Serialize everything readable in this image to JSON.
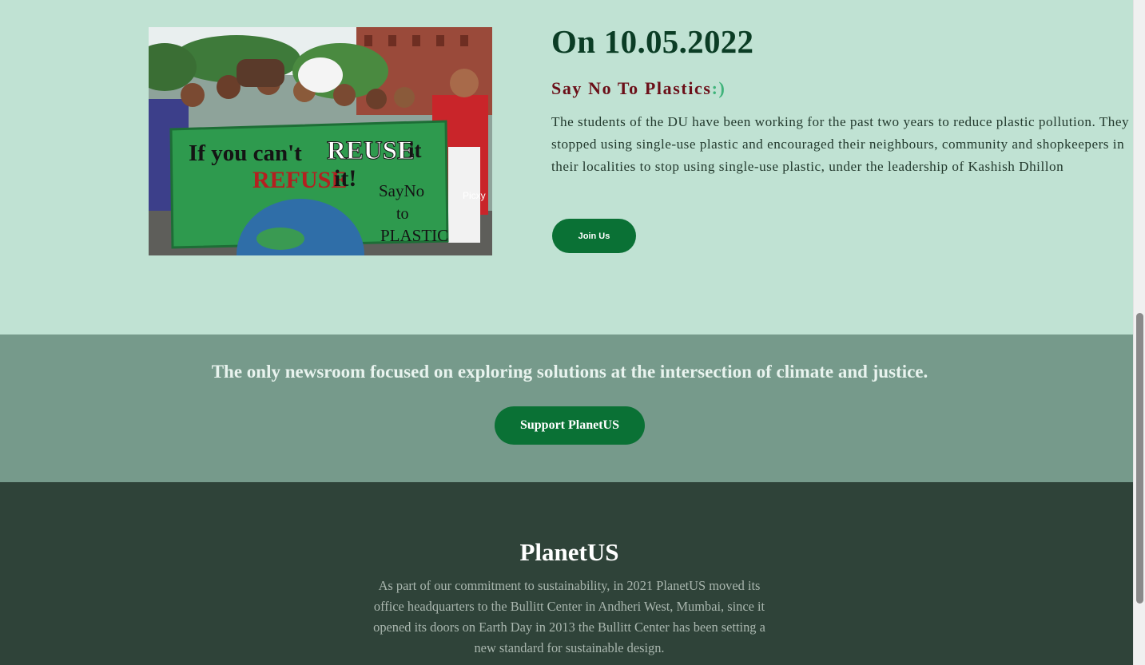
{
  "event": {
    "title": "On 10.05.2022",
    "subtitle": "Say No To Plastics",
    "subtitle_emoticon": ":)",
    "description": "The students of the DU have been working for the past two years to reduce plastic pollution. They stopped using single-use plastic and encouraged their neighbours, community and shopkeepers in their localities to stop using single-use plastic, under the leadership of Kashish Dhillon",
    "join_label": "Join Us",
    "photo": {
      "banner_line1_a": "If you can't",
      "banner_line1_b": "REUSE",
      "banner_line1_c": "it",
      "banner_line2_a": "REFUSE",
      "banner_line2_b": "it!",
      "banner_side_1": "SayNo",
      "banner_side_2": "to",
      "banner_side_3": "PLASTIC",
      "watermark": "Picxy"
    }
  },
  "support": {
    "tagline": "The only newsroom focused on exploring solutions at the intersection of climate and justice.",
    "button_label": "Support PlanetUS"
  },
  "footer": {
    "title": "PlanetUS",
    "description": "As part of our commitment to sustainability, in 2021 PlanetUS moved its office headquarters to the Bullitt Center in Andheri West, Mumbai, since it opened its doors on Earth Day in 2013 the Bullitt Center has been setting a new standard for sustainable design."
  },
  "colors": {
    "event_bg": "#c0e2d3",
    "support_bg": "#769a8b",
    "footer_bg": "#2f4339",
    "button_green": "#0a7135",
    "title_dark_green": "#0b3d25",
    "subtitle_maroon": "#6b0f18"
  }
}
